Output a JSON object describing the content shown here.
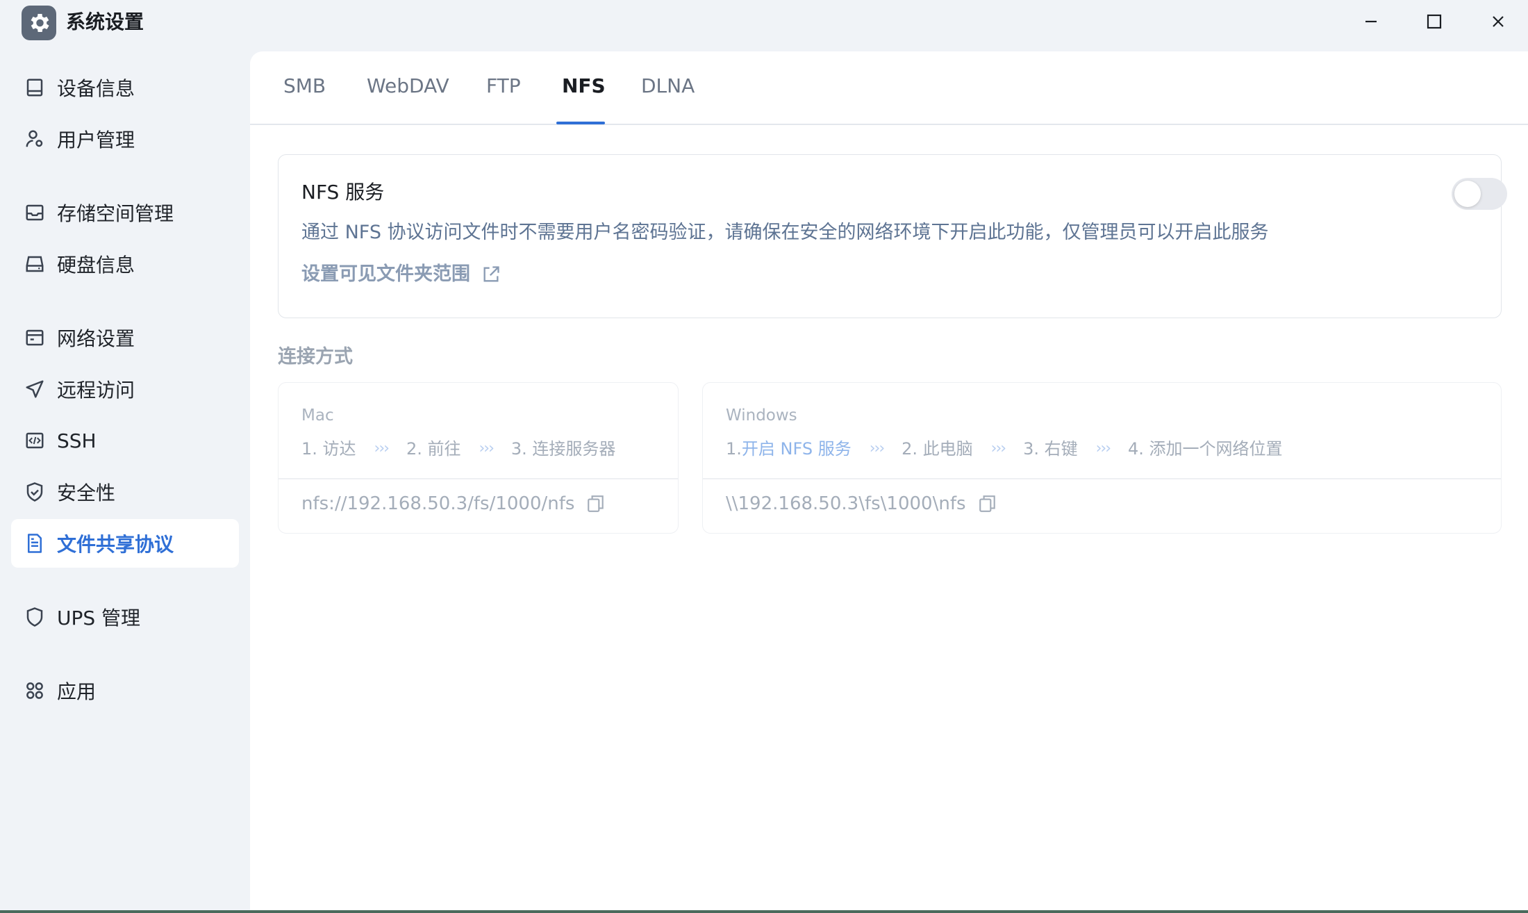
{
  "window": {
    "title": "系统设置",
    "controls": {
      "minimize": "minimize-icon",
      "maximize": "maximize-icon",
      "close": "close-icon"
    }
  },
  "sidebar": {
    "items": [
      {
        "label": "设备信息",
        "icon": "device-icon"
      },
      {
        "label": "用户管理",
        "icon": "user-gear-icon"
      },
      {
        "label": "存储空间管理",
        "icon": "storage-icon"
      },
      {
        "label": "硬盘信息",
        "icon": "disk-icon"
      },
      {
        "label": "网络设置",
        "icon": "network-icon"
      },
      {
        "label": "远程访问",
        "icon": "send-icon"
      },
      {
        "label": "SSH",
        "icon": "code-icon"
      },
      {
        "label": "安全性",
        "icon": "shield-check-icon"
      },
      {
        "label": "文件共享协议",
        "icon": "document-icon",
        "active": true
      },
      {
        "label": "UPS 管理",
        "icon": "shield-icon"
      },
      {
        "label": "应用",
        "icon": "apps-icon"
      }
    ]
  },
  "tabs": [
    {
      "label": "SMB"
    },
    {
      "label": "WebDAV"
    },
    {
      "label": "FTP"
    },
    {
      "label": "NFS",
      "active": true
    },
    {
      "label": "DLNA"
    }
  ],
  "service": {
    "title": "NFS 服务",
    "enabled": false,
    "description": "通过 NFS 协议访问文件时不需要用户名密码验证，请确保在安全的网络环境下开启此功能，仅管理员可以开启此服务",
    "link": "设置可见文件夹范围"
  },
  "connection": {
    "title": "连接方式",
    "mac": {
      "os": "Mac",
      "steps": [
        "1. 访达",
        "2. 前往",
        "3. 连接服务器"
      ],
      "path": "nfs://192.168.50.3/fs/1000/nfs"
    },
    "windows": {
      "os": "Windows",
      "step1_prefix": "1. ",
      "step1_link": "开启 NFS 服务",
      "steps": [
        "2. 此电脑",
        "3. 右键",
        "4. 添加一个网络位置"
      ],
      "path": "\\\\192.168.50.3\\fs\\1000\\nfs"
    },
    "separator": "›››"
  },
  "colors": {
    "accent": "#2f6fd6",
    "sidebar_bg": "#f0f3f7",
    "description": "#5e7493"
  }
}
